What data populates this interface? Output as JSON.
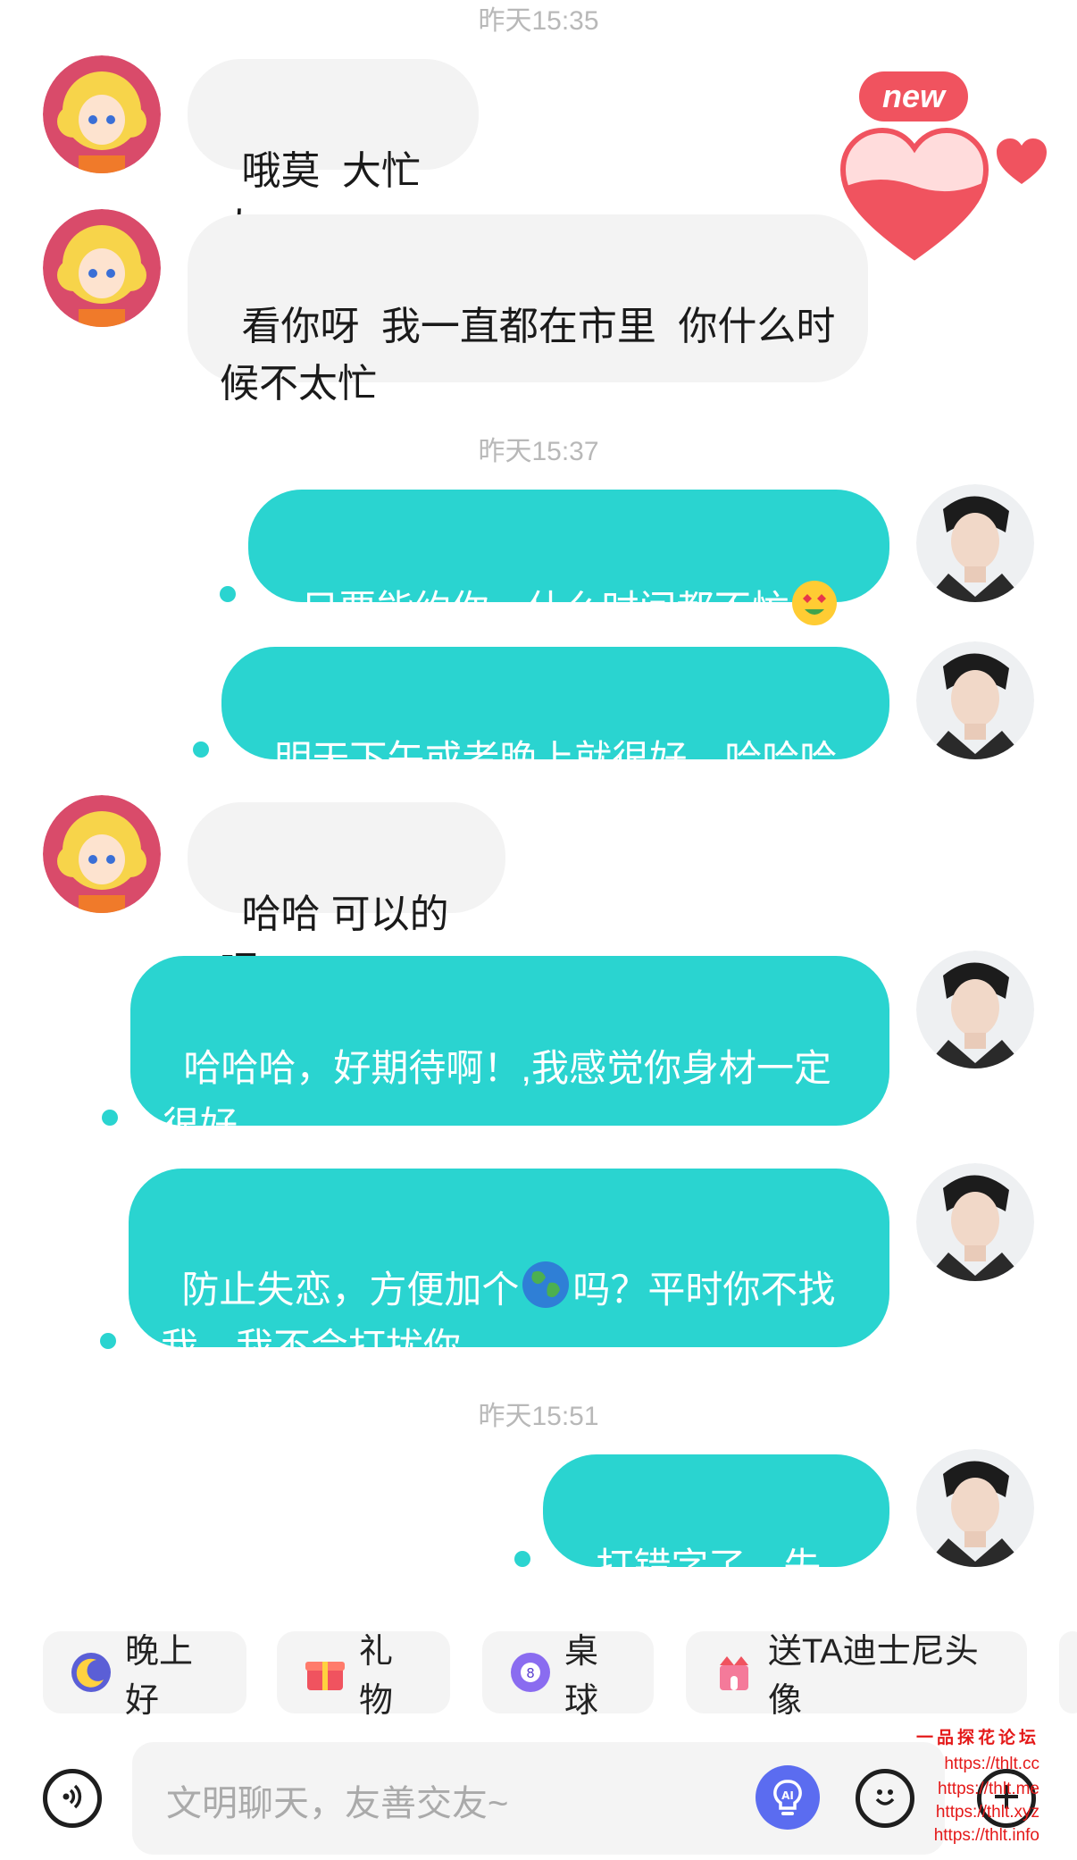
{
  "timestamps": [
    "昨天15:35",
    "昨天15:37",
    "昨天15:51"
  ],
  "messages": [
    {
      "from": "them",
      "text": "哦莫  大忙人"
    },
    {
      "from": "them",
      "text": "看你呀  我一直都在市里  你什么时候不太忙"
    },
    {
      "from": "me",
      "text": "只要能约你，什么时间都不忙",
      "emoji": "heart-eyes-emoji"
    },
    {
      "from": "me",
      "text": "明天下午或者晚上就很好，哈哈哈"
    },
    {
      "from": "them",
      "text": "哈哈 可以的呢"
    },
    {
      "from": "me",
      "text": "哈哈哈，好期待啊！,我感觉你身材一定很好"
    },
    {
      "from": "me",
      "text_before": "防止失恋，方便加个",
      "emoji": "globe-emoji",
      "text_after": "吗？平时你不找我，我不会打扰你"
    },
    {
      "from": "me",
      "text": "打错字了，失联"
    }
  ],
  "badge": {
    "new_label": "new"
  },
  "quick_replies": [
    {
      "label": "晚上好",
      "icon": "moon-icon"
    },
    {
      "label": "礼物",
      "icon": "gift-icon"
    },
    {
      "label": "桌球",
      "icon": "billiard-ball-icon"
    },
    {
      "label": "送TA迪士尼头像",
      "icon": "castle-icon"
    }
  ],
  "input": {
    "placeholder": "文明聊天，友善交友~"
  },
  "watermark": [
    "一品探花论坛",
    "https://thlt.cc",
    "https://thlt.me",
    "https://thlt.xyz",
    "https://thlt.info"
  ],
  "colors": {
    "outgoing_bubble": "#2ad4d0",
    "incoming_bubble": "#f3f3f3",
    "heart": "#f0535f",
    "new_badge": "#f0535f"
  }
}
